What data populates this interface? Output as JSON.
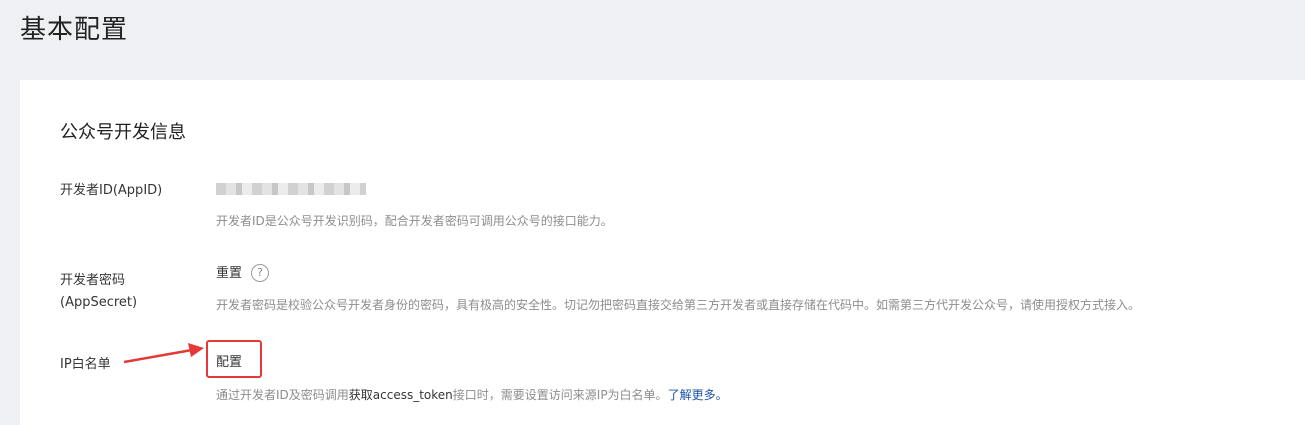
{
  "page": {
    "title": "基本配置"
  },
  "dev_info": {
    "section_title": "公众号开发信息",
    "app_id": {
      "label": "开发者ID(AppID)",
      "description": "开发者ID是公众号开发识别码，配合开发者密码可调用公众号的接口能力。"
    },
    "app_secret": {
      "label_line1": "开发者密码",
      "label_line2": "(AppSecret)",
      "reset_label": "重置",
      "help_glyph": "?",
      "description": "开发者密码是校验公众号开发者身份的密码，具有极高的安全性。切记勿把密码直接交给第三方开发者或直接存储在代码中。如需第三方代开发公众号，请使用授权方式接入。"
    },
    "ip_whitelist": {
      "label": "IP白名单",
      "config_label": "配置",
      "description_prefix": "通过开发者ID及密码调用",
      "description_token": "获取access_token",
      "description_middle": "接口时，需要设置访问来源IP为白名单。",
      "learn_more": "了解更多。"
    }
  },
  "annotation": {
    "color": "#e53935"
  }
}
